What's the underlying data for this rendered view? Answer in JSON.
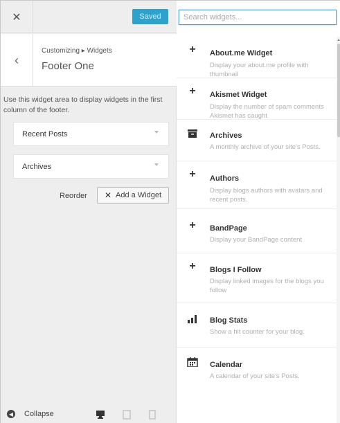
{
  "topbar": {
    "close_glyph": "✕",
    "saved_label": "Saved"
  },
  "header": {
    "back_glyph": "‹",
    "breadcrumb": "Customizing ▸ Widgets",
    "title": "Footer One"
  },
  "area_description": "Use this widget area to display widgets in the first column of the footer.",
  "area_widgets": [
    {
      "label": "Recent Posts"
    },
    {
      "label": "Archives"
    }
  ],
  "actions": {
    "reorder_label": "Reorder",
    "add_widget_label": "Add a Widget",
    "add_widget_glyph": "✕"
  },
  "footer": {
    "collapse_label": "Collapse",
    "collapse_glyph": "◀",
    "devices": [
      "desktop-icon",
      "tablet-icon",
      "mobile-icon"
    ]
  },
  "search": {
    "placeholder": "Search widgets..."
  },
  "available_widgets": [
    {
      "icon": "plus-icon",
      "glyph": "+",
      "name": "About.me Widget",
      "description": "Display your about.me profile with thumbnail"
    },
    {
      "icon": "plus-icon",
      "glyph": "+",
      "name": "Akismet Widget",
      "description": "Display the number of spam comments Akismet has caught"
    },
    {
      "icon": "archive-icon",
      "glyph": "▬",
      "name": "Archives",
      "description": "A monthly archive of your site's Posts."
    },
    {
      "icon": "plus-icon",
      "glyph": "+",
      "name": "Authors",
      "description": "Display blogs authors with avatars and recent posts."
    },
    {
      "icon": "plus-icon",
      "glyph": "+",
      "name": "BandPage",
      "description": "Display your BandPage content"
    },
    {
      "icon": "plus-icon",
      "glyph": "+",
      "name": "Blogs I Follow",
      "description": "Display linked images for the blogs you follow"
    },
    {
      "icon": "bar-chart-icon",
      "glyph": "▁▃▅",
      "name": "Blog Stats",
      "description": "Show a hit counter for your blog."
    },
    {
      "icon": "calendar-icon",
      "glyph": "▦",
      "name": "Calendar",
      "description": "A calendar of your site's Posts."
    }
  ],
  "colors": {
    "accent": "#2ea2cc",
    "panel_bg": "#eeeeee",
    "focus_border": "#5b9dd9"
  }
}
